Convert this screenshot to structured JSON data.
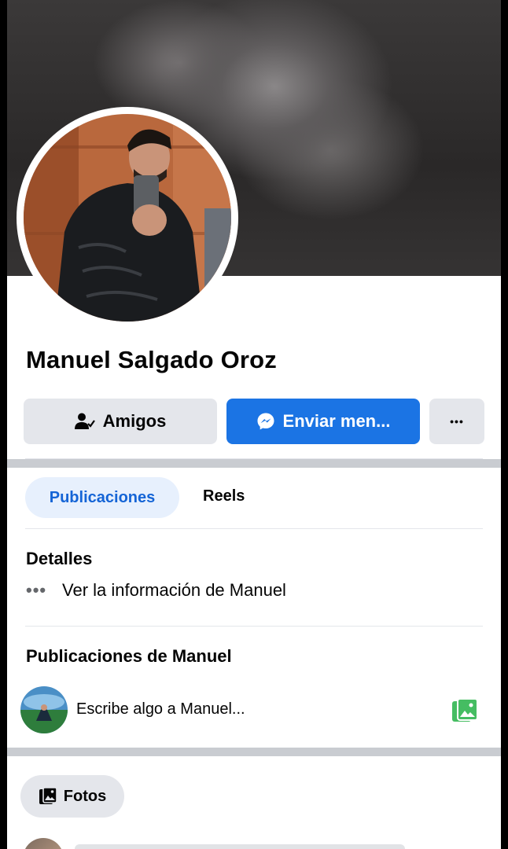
{
  "profile": {
    "name": "Manuel Salgado Oroz"
  },
  "actions": {
    "friends_label": "Amigos",
    "message_label": "Enviar men...",
    "more_label": "•••"
  },
  "tabs": [
    {
      "label": "Publicaciones",
      "active": true
    },
    {
      "label": "Reels",
      "active": false
    }
  ],
  "details": {
    "heading": "Detalles",
    "dots": "•••",
    "link_text": "Ver la información de Manuel"
  },
  "posts": {
    "heading": "Publicaciones de Manuel",
    "composer_placeholder": "Escribe algo a Manuel..."
  },
  "photos": {
    "label": "Fotos"
  },
  "colors": {
    "accent": "#1b74e4",
    "tab_active_bg": "#e7f0fd",
    "tab_active_text": "#1464d6",
    "button_grey": "#e4e6eb",
    "photo_icon": "#45bd62"
  },
  "icons": {
    "friends": "person-check-icon",
    "messenger": "messenger-icon",
    "more": "more-dots-icon",
    "info": "dots-icon",
    "photo": "photo-icon",
    "fotos": "photo-album-icon"
  }
}
